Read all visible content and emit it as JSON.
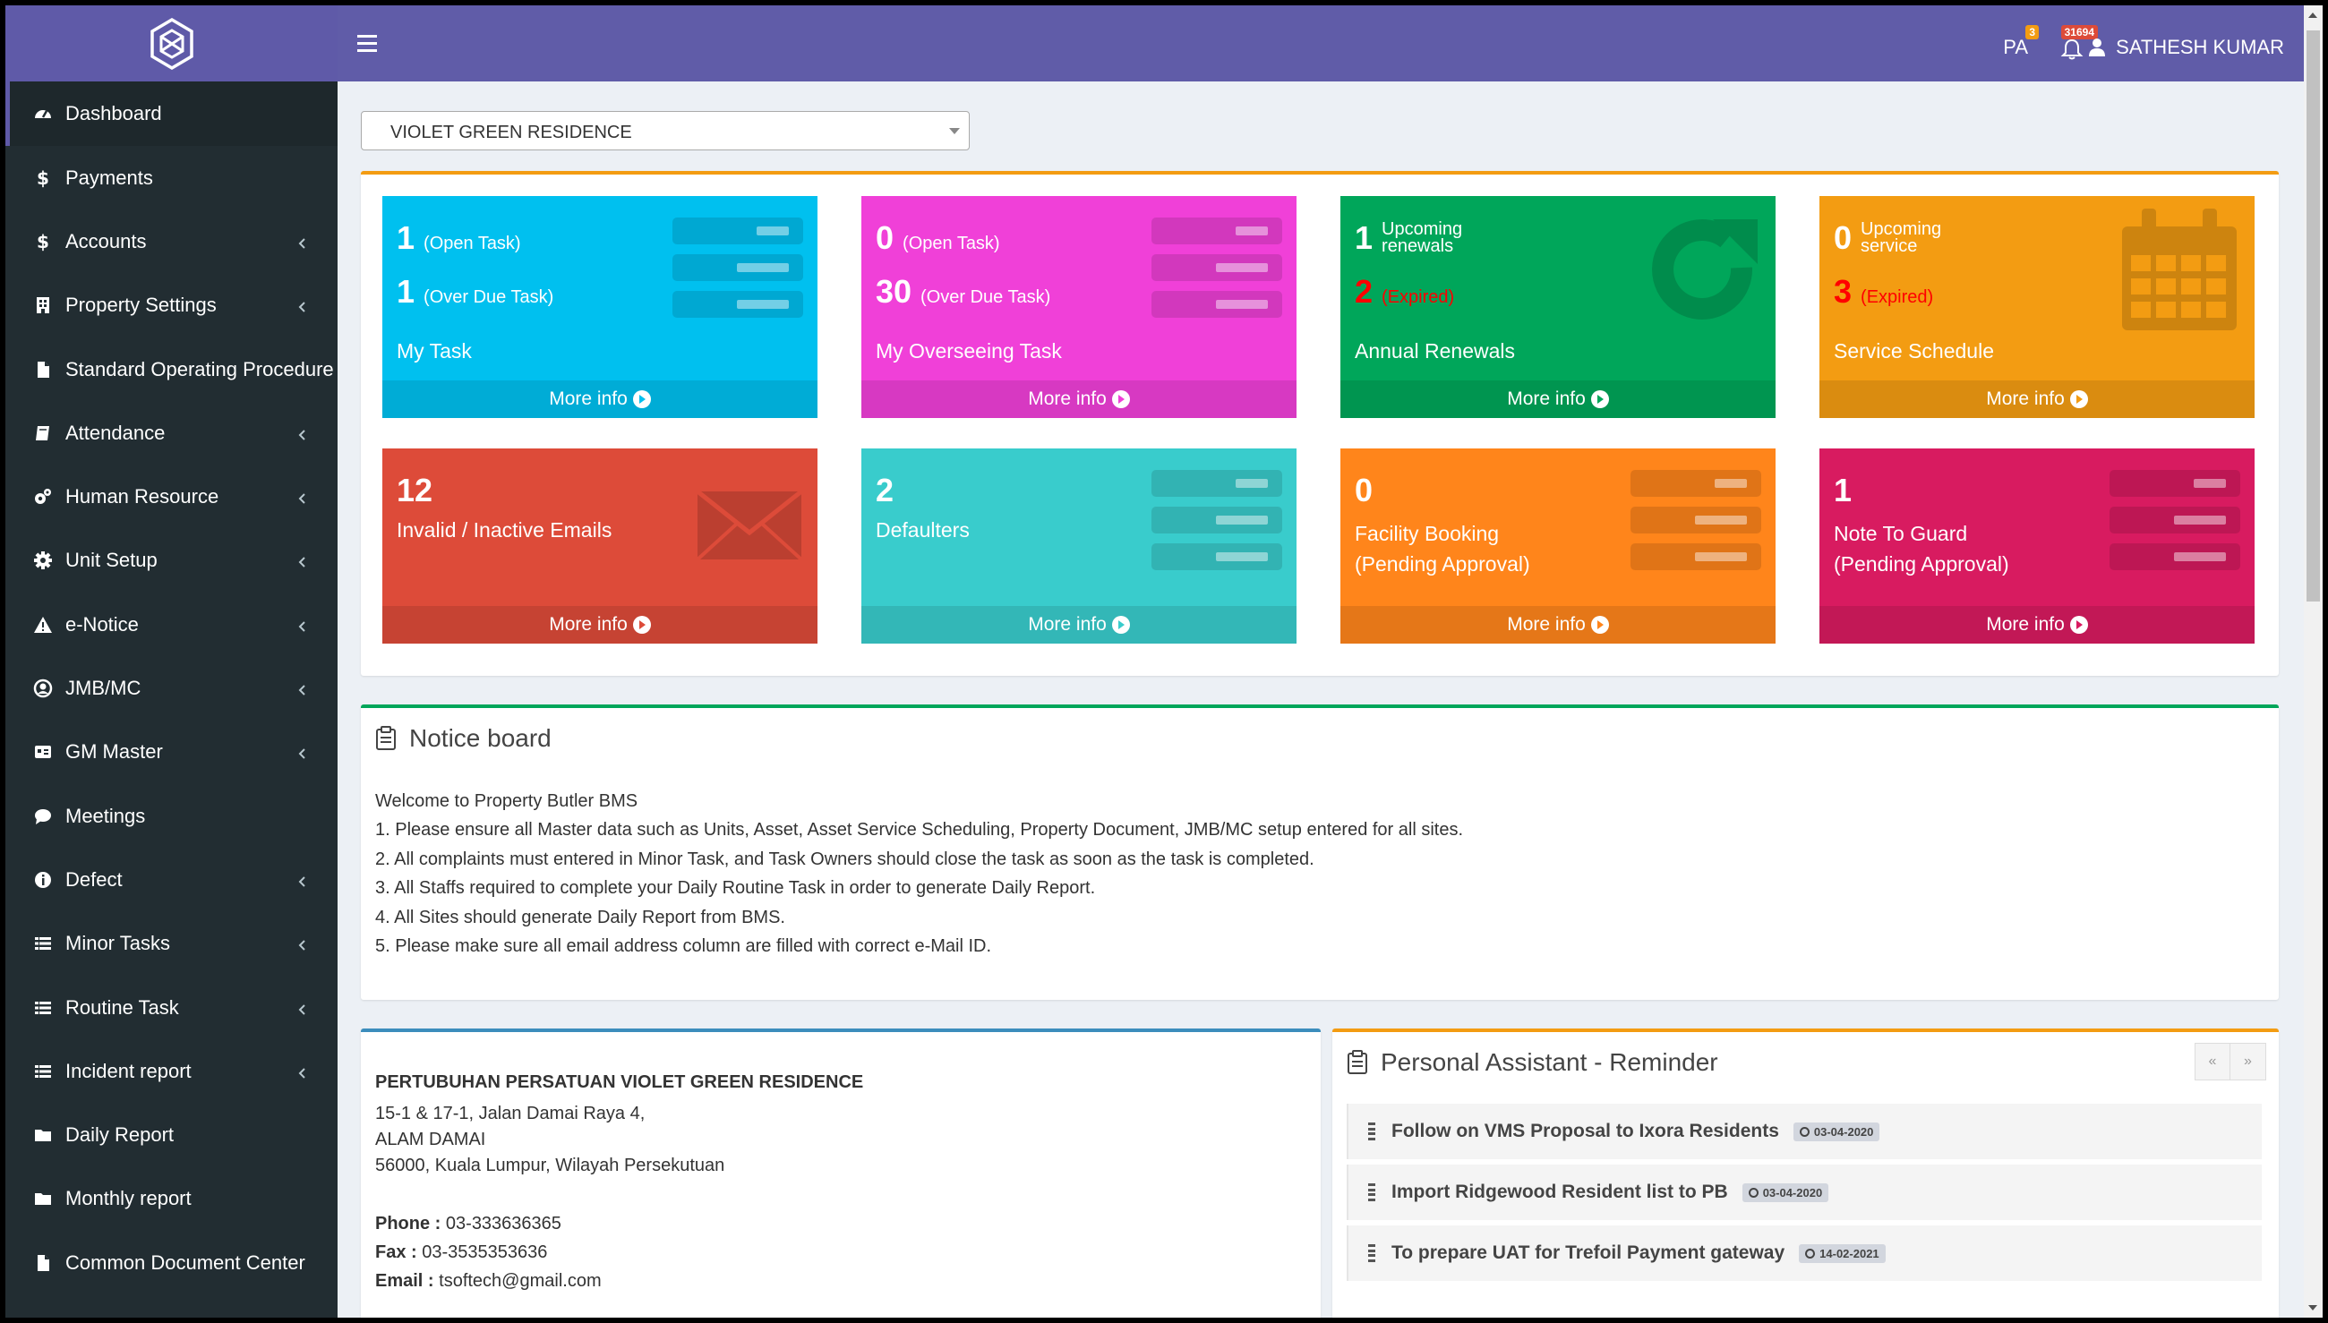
{
  "sidebar": {
    "items": [
      {
        "label": "Dashboard",
        "icon": "dashboard-icon",
        "active": true,
        "has_children": false
      },
      {
        "label": "Payments",
        "icon": "dollar-icon",
        "active": false,
        "has_children": false
      },
      {
        "label": "Accounts",
        "icon": "dollar-icon",
        "active": false,
        "has_children": true
      },
      {
        "label": "Property Settings",
        "icon": "building-icon",
        "active": false,
        "has_children": true
      },
      {
        "label": "Standard Operating Procedure",
        "icon": "file-icon",
        "active": false,
        "has_children": false
      },
      {
        "label": "Attendance",
        "icon": "book-icon",
        "active": false,
        "has_children": true
      },
      {
        "label": "Human Resource",
        "icon": "cogs-icon",
        "active": false,
        "has_children": true
      },
      {
        "label": "Unit Setup",
        "icon": "gear-icon",
        "active": false,
        "has_children": true
      },
      {
        "label": "e-Notice",
        "icon": "warning-icon",
        "active": false,
        "has_children": true
      },
      {
        "label": "JMB/MC",
        "icon": "user-circle-icon",
        "active": false,
        "has_children": true
      },
      {
        "label": "GM Master",
        "icon": "id-card-icon",
        "active": false,
        "has_children": true
      },
      {
        "label": "Meetings",
        "icon": "comment-icon",
        "active": false,
        "has_children": false
      },
      {
        "label": "Defect",
        "icon": "info-icon",
        "active": false,
        "has_children": true
      },
      {
        "label": "Minor Tasks",
        "icon": "list-icon",
        "active": false,
        "has_children": true
      },
      {
        "label": "Routine Task",
        "icon": "list-icon",
        "active": false,
        "has_children": true
      },
      {
        "label": "Incident report",
        "icon": "list-icon",
        "active": false,
        "has_children": true
      },
      {
        "label": "Daily Report",
        "icon": "folder-icon",
        "active": false,
        "has_children": false
      },
      {
        "label": "Monthly report",
        "icon": "folder-icon",
        "active": false,
        "has_children": false
      },
      {
        "label": "Common Document Center",
        "icon": "file-icon",
        "active": false,
        "has_children": false
      }
    ]
  },
  "header": {
    "pa_label": "PA",
    "pa_badge": "3",
    "notification_badge": "31694",
    "user_name": "SATHESH KUMAR"
  },
  "property_select": {
    "value": "VIOLET GREEN RESIDENCE"
  },
  "tiles": {
    "my_task": {
      "open_count": "1",
      "open_label": "(Open Task)",
      "overdue_count": "1",
      "overdue_label": "(Over Due Task)",
      "title": "My Task",
      "more": "More info",
      "color": "#00c0ef"
    },
    "overseeing": {
      "open_count": "0",
      "open_label": "(Open Task)",
      "overdue_count": "30",
      "overdue_label": "(Over Due Task)",
      "title": "My Overseeing Task",
      "more": "More info",
      "color": "#f040d8"
    },
    "renewals": {
      "upcoming_count": "1",
      "upcoming_label_1": "Upcoming",
      "upcoming_label_2": "renewals",
      "expired_count": "2",
      "expired_label": "(Expired)",
      "title": "Annual Renewals",
      "more": "More info",
      "color": "#00a65a"
    },
    "service": {
      "upcoming_count": "0",
      "upcoming_label_1": "Upcoming",
      "upcoming_label_2": "service",
      "expired_count": "3",
      "expired_label": "(Expired)",
      "title": "Service Schedule",
      "more": "More info",
      "color": "#f39c12"
    },
    "emails": {
      "count": "12",
      "title": "Invalid / Inactive Emails",
      "more": "More info",
      "color": "#dd4b39"
    },
    "defaulters": {
      "count": "2",
      "title": "Defaulters",
      "more": "More info",
      "color": "#39cccc"
    },
    "facility": {
      "count": "0",
      "title_1": "Facility Booking",
      "title_2": "(Pending Approval)",
      "more": "More info",
      "color": "#ff851b"
    },
    "guard": {
      "count": "1",
      "title_1": "Note To Guard",
      "title_2": "(Pending Approval)",
      "more": "More info",
      "color": "#d81b60"
    }
  },
  "notice": {
    "title": "Notice board",
    "lines": [
      "Welcome to Property Butler BMS",
      "1. Please ensure all Master data such as Units, Asset, Asset Service Scheduling, Property Document, JMB/MC setup entered for all sites.",
      "2. All complaints must entered in Minor Task, and Task Owners should close the task as soon as the task is completed.",
      "3. All Staffs required to complete your Daily Routine Task in order to generate Daily Report.",
      "4. All Sites should generate Daily Report from BMS.",
      "5. Please make sure all email address column are filled with correct e-Mail ID."
    ]
  },
  "address": {
    "org": "PERTUBUHAN PERSATUAN VIOLET GREEN RESIDENCE",
    "line1": "15-1 & 17-1, Jalan Damai Raya 4,",
    "line2": "ALAM DAMAI",
    "line3": "56000, Kuala Lumpur, Wilayah Persekutuan",
    "phone_label": "Phone :",
    "phone": "03-333636365",
    "fax_label": "Fax :",
    "fax": "03-3535353636",
    "email_label": "Email :",
    "email": "tsoftech@gmail.com"
  },
  "reminder": {
    "title": "Personal Assistant - Reminder",
    "prev": "«",
    "next": "»",
    "items": [
      {
        "text": "Follow on VMS Proposal to Ixora Residents",
        "date": "03-04-2020"
      },
      {
        "text": "Import Ridgewood Resident list to PB",
        "date": "03-04-2020"
      },
      {
        "text": "To prepare UAT for Trefoil Payment gateway",
        "date": "14-02-2021"
      }
    ]
  }
}
